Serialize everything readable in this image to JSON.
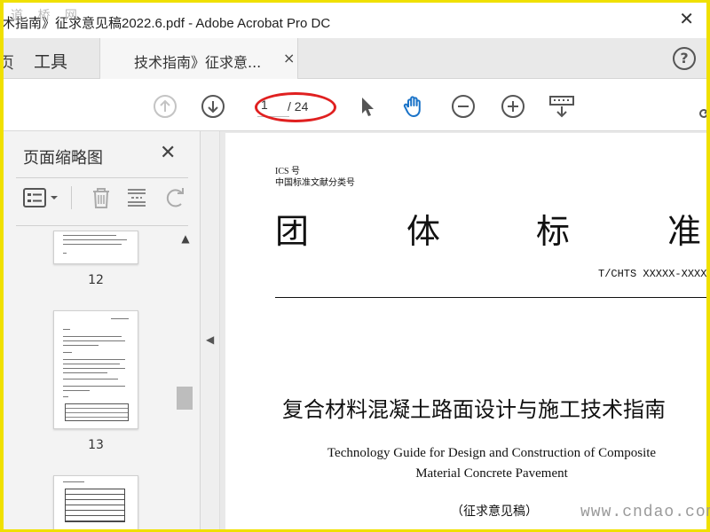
{
  "window": {
    "title": "术指南》征求意见稿2022.6.pdf - Adobe Acrobat Pro DC",
    "close_glyph": "✕"
  },
  "watermarks": {
    "top": "道 桥 网",
    "bottom": "www.cndao.com"
  },
  "tabs": {
    "home_label": "页",
    "tools_label": "工具",
    "document_label": "技术指南》征求意...",
    "document_close": "×",
    "help_glyph": "?"
  },
  "toolbar": {
    "page_current": "1",
    "page_total": "/ 24",
    "icons": [
      "prev-page-icon",
      "next-page-icon",
      "select-pointer-icon",
      "hand-tool-icon",
      "zoom-out-icon",
      "zoom-in-icon",
      "marquee-zoom-icon",
      "sign-icon"
    ]
  },
  "sidebar": {
    "title": "页面缩略图",
    "close_glyph": "✕",
    "thumbnails": [
      {
        "page_number": "12"
      },
      {
        "page_number": "13"
      }
    ]
  },
  "document": {
    "ics": "ICS 号",
    "classification": "中国标准文献分类号",
    "title_chars": [
      "团",
      "体",
      "标",
      "准"
    ],
    "standard_number": "T/CHTS XXXXX-XXXX",
    "cn_title": "复合材料混凝土路面设计与施工技术指南",
    "en_title_line1": "Technology Guide for Design and Construction of Composite",
    "en_title_line2": "Material Concrete Pavement",
    "draft_label": "（征求意见稿）"
  },
  "colors": {
    "highlight_oval": "#e02020",
    "accent_blue": "#1a73c8",
    "frame_border": "#f0e000"
  }
}
